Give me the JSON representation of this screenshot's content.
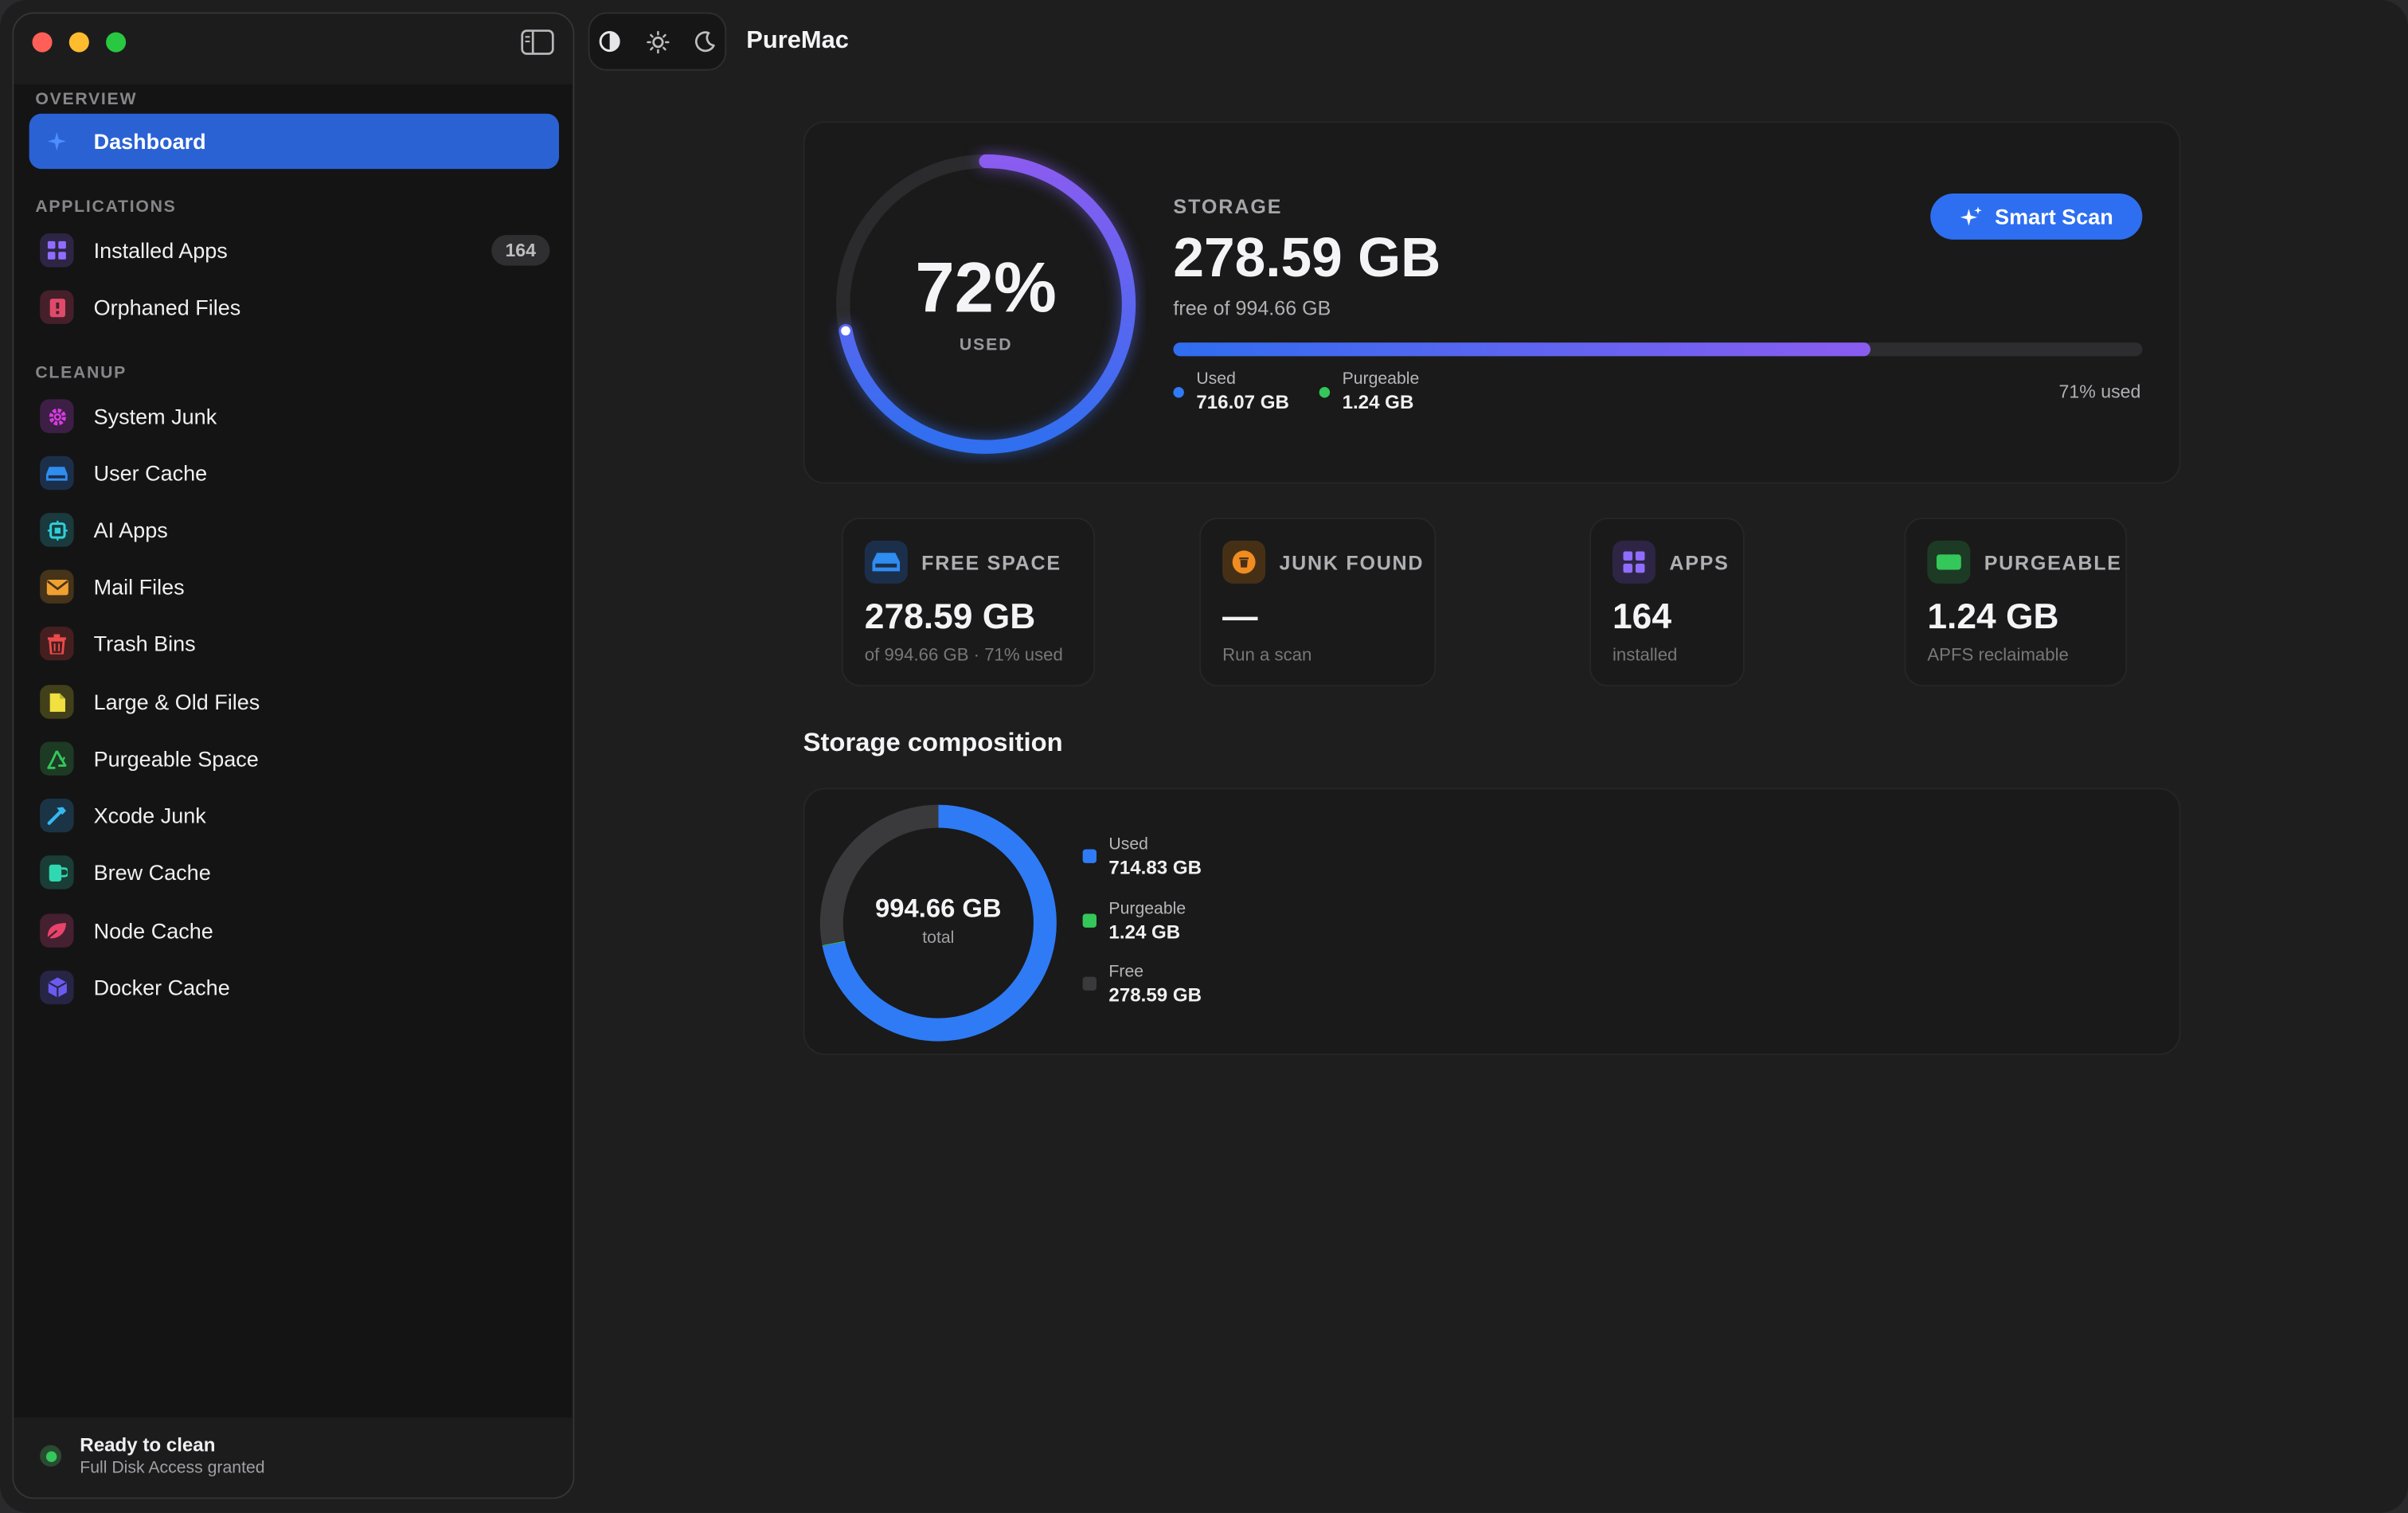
{
  "app": {
    "title": "PureMac"
  },
  "sidebar": {
    "sections": {
      "overview": "OVERVIEW",
      "applications": "APPLICATIONS",
      "cleanup": "CLEANUP"
    },
    "items": [
      {
        "label": "Dashboard",
        "icon": "sparkle-icon",
        "color": "#2a62d4",
        "active": true
      },
      {
        "label": "Installed Apps",
        "icon": "grid-icon",
        "color": "#7a5af8",
        "count": "164"
      },
      {
        "label": "Orphaned Files",
        "icon": "document-icon",
        "color": "#e04a6a"
      },
      {
        "label": "System Junk",
        "icon": "gear-icon",
        "color": "#d63de0"
      },
      {
        "label": "User Cache",
        "icon": "drive-icon",
        "color": "#2f8cf0"
      },
      {
        "label": "AI Apps",
        "icon": "chip-icon",
        "color": "#2ed0d8"
      },
      {
        "label": "Mail Files",
        "icon": "envelope-icon",
        "color": "#f0a030"
      },
      {
        "label": "Trash Bins",
        "icon": "trash-icon",
        "color": "#ef4b4b"
      },
      {
        "label": "Large & Old Files",
        "icon": "file-icon",
        "color": "#f0e040"
      },
      {
        "label": "Purgeable Space",
        "icon": "recycle-icon",
        "color": "#34c759"
      },
      {
        "label": "Xcode Junk",
        "icon": "hammer-icon",
        "color": "#35b8f0"
      },
      {
        "label": "Brew Cache",
        "icon": "mug-icon",
        "color": "#2fd8b0"
      },
      {
        "label": "Node Cache",
        "icon": "leaf-icon",
        "color": "#e8436a"
      },
      {
        "label": "Docker Cache",
        "icon": "cube-icon",
        "color": "#6b5af0"
      }
    ],
    "status": {
      "title": "Ready to clean",
      "subtitle": "Full Disk Access granted"
    }
  },
  "storage": {
    "percent_used": 0.72,
    "percent_label": "72%",
    "used_caption": "USED",
    "label": "STORAGE",
    "free_value": "278.59 GB",
    "of_text": "free of 994.66 GB",
    "smart_scan_label": "Smart Scan",
    "bar_fraction": 0.72,
    "used_key": "Used",
    "used_value": "716.07 GB",
    "purgeable_key": "Purgeable",
    "purgeable_value": "1.24 GB",
    "used_percent_text": "71% used"
  },
  "stats": [
    {
      "title": "FREE SPACE",
      "value": "278.59 GB",
      "sub": "of 994.66 GB · 71% used",
      "icon": "drive-icon",
      "color": "#2f8cf0"
    },
    {
      "title": "JUNK FOUND",
      "value": "—",
      "sub": "Run a scan",
      "icon": "trash-icon",
      "color": "#f08c20"
    },
    {
      "title": "APPS",
      "value": "164",
      "sub": "installed",
      "icon": "grid-icon",
      "color": "#7a5af8"
    },
    {
      "title": "PURGEABLE",
      "value": "1.24 GB",
      "sub": "APFS reclaimable",
      "icon": "memory-icon",
      "color": "#34c759"
    }
  ],
  "composition": {
    "title": "Storage composition",
    "total_value": "994.66 GB",
    "total_label": "total",
    "legend": [
      {
        "key": "Used",
        "value": "714.83 GB",
        "color": "#2f7bf5"
      },
      {
        "key": "Purgeable",
        "value": "1.24 GB",
        "color": "#34c759"
      },
      {
        "key": "Free",
        "value": "278.59 GB",
        "color": "#3a3a3c"
      }
    ]
  }
}
